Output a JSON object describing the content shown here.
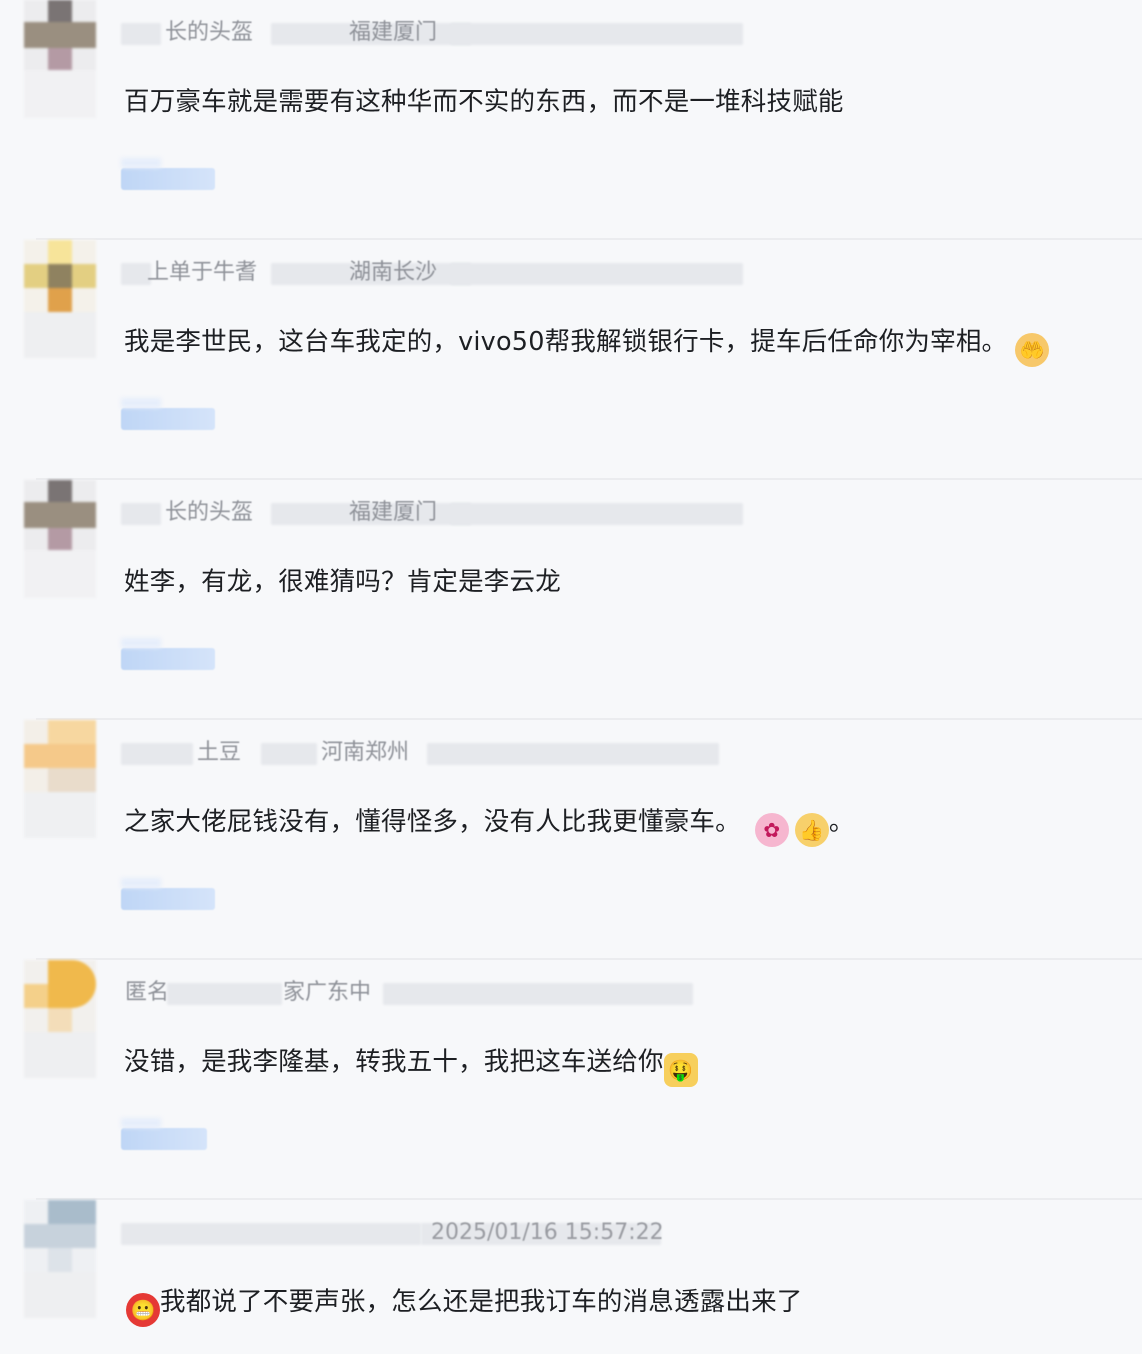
{
  "comments": [
    {
      "user": "长的头盔",
      "location": "福建厦门",
      "text": "百万豪车就是需要有这种华而不实的东西，而不是一堆科技赋能",
      "emojis": []
    },
    {
      "user": "上单于牛耆",
      "location": "湖南长沙",
      "text": "我是李世民，这台车我定的，vivo50帮我解锁银行卡，提车后任命你为宰相。",
      "emojis": [
        "hands-emoji"
      ]
    },
    {
      "user": "长的头盔",
      "location": "福建厦门",
      "text": "姓李，有龙，很难猜吗？肯定是李云龙",
      "emojis": []
    },
    {
      "user": "土豆",
      "location": "河南郑州",
      "text": "之家大佬屁钱没有，懂得怪多，没有人比我更懂豪车。",
      "emojis": [
        "flower-emoji",
        "thumbs-emoji"
      ],
      "tail": "。"
    },
    {
      "user": "匿名",
      "location": "家广东中",
      "text": "没错，是我李隆基，转我五十，我把这车送给你",
      "emojis": [
        "money-face-emoji"
      ]
    },
    {
      "user": "",
      "location": "",
      "timestamp": "2025/01/16 15:57:22",
      "text": "我都说了不要声张，怎么还是把我订车的消息透露出来了",
      "emojis": [
        "grimace-emoji"
      ],
      "emoji_position": "before"
    }
  ]
}
